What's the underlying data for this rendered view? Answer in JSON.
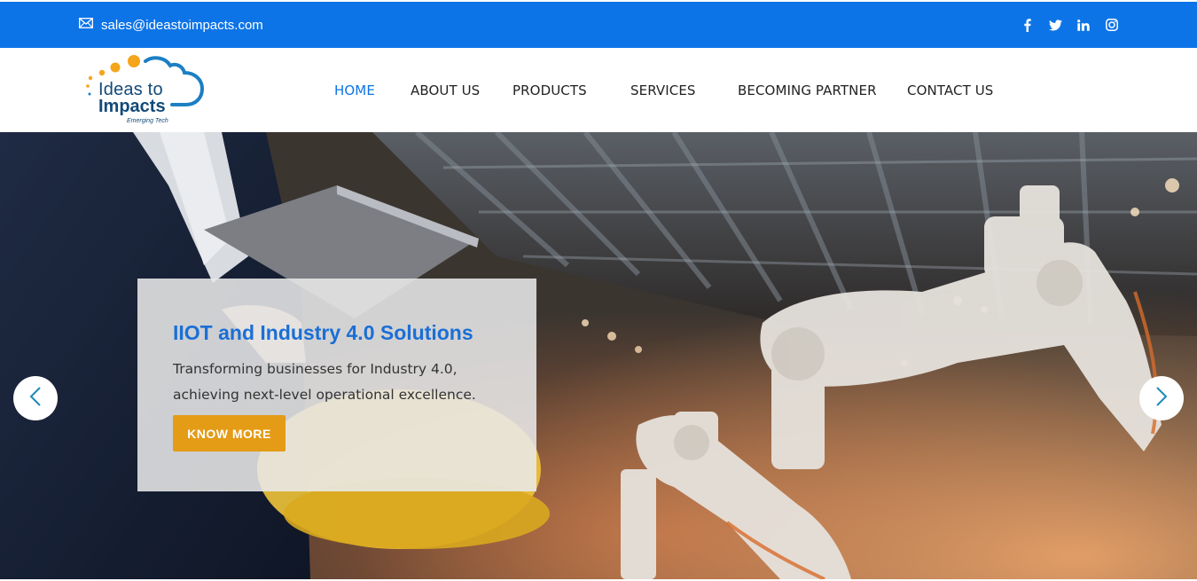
{
  "topbar": {
    "email": "sales@ideastoimpacts.com",
    "background": "#0d74e7",
    "social_icons": [
      "facebook-icon",
      "twitter-icon",
      "linkedin-icon",
      "instagram-icon"
    ]
  },
  "logo": {
    "line1": "Ideas to",
    "line2": "Impacts",
    "tagline": "Emerging Tech"
  },
  "nav": {
    "items": [
      {
        "label": "HOME",
        "active": true
      },
      {
        "label": "ABOUT US",
        "active": false
      },
      {
        "label": "PRODUCTS",
        "active": false
      },
      {
        "label": "SERVICES",
        "active": false
      },
      {
        "label": "BECOMING PARTNER",
        "active": false
      },
      {
        "label": "CONTACT US",
        "active": false
      }
    ],
    "active_color": "#0d74e7"
  },
  "hero": {
    "title": "IIOT and Industry 4.0 Solutions",
    "description": "Transforming businesses for Industry 4.0, achieving next-level operational excellence.",
    "button_label": "KNOW MORE",
    "button_color": "#e49b16",
    "prev_icon": "chevron-left-icon",
    "next_icon": "chevron-right-icon"
  }
}
